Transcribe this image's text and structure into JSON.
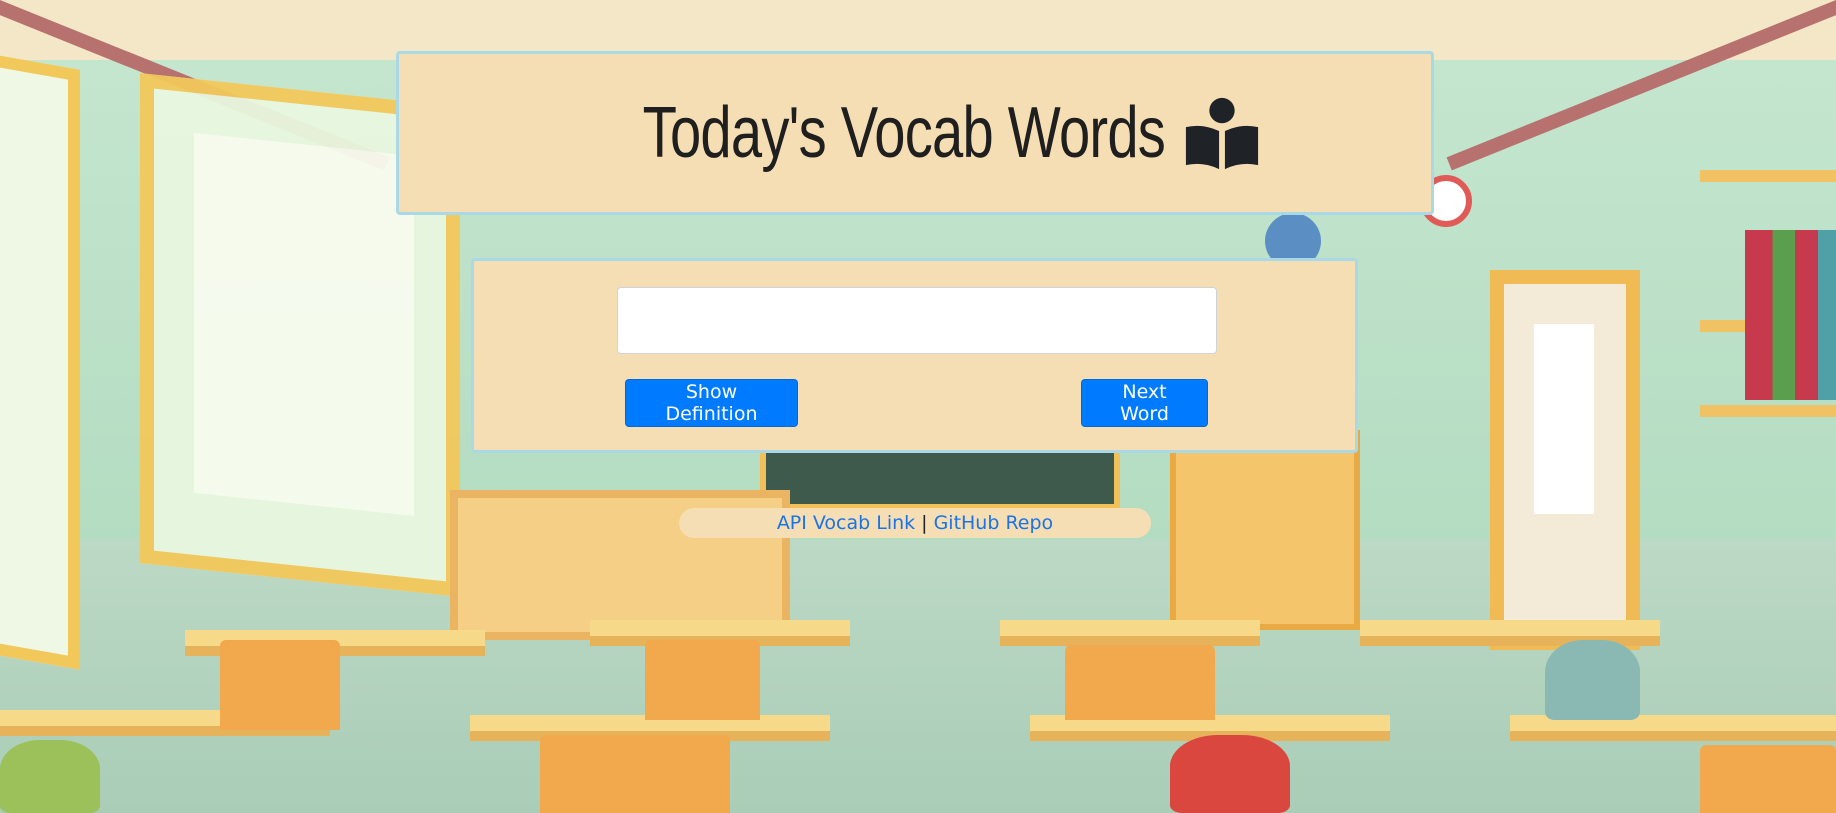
{
  "header": {
    "title": "Today's Vocab Words",
    "icon": "book-reader-icon"
  },
  "vocab": {
    "word_value": "",
    "show_definition_label": "Show Definition",
    "next_word_label": "Next Word"
  },
  "footer": {
    "api_link_label": "API Vocab Link",
    "separator": "|",
    "github_link_label": "GitHub Repo"
  },
  "colors": {
    "card_background": "#f5deb3",
    "card_border": "#a9d8e6",
    "button_primary": "#007bff",
    "link": "#1a73e8"
  }
}
